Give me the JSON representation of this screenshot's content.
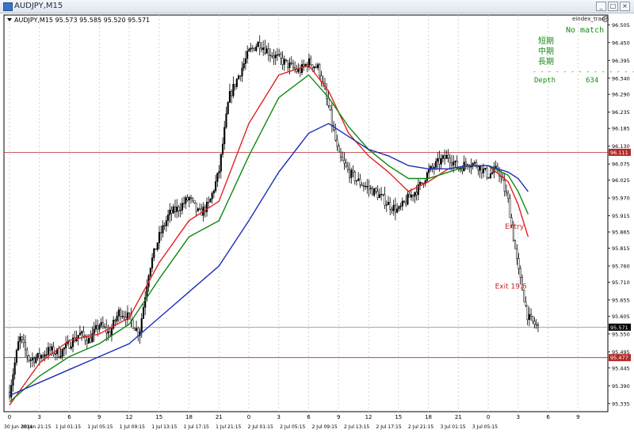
{
  "window": {
    "title": "AUDJPY,M15",
    "buttons": [
      "_",
      "□",
      "×"
    ]
  },
  "chart_info": "AUDJPY,M15  95.573 95.585 95.520 95.571",
  "indicator": {
    "name": "eindex_trade",
    "status": "No match",
    "labels": [
      "短期",
      "中期",
      "長期"
    ],
    "separator": "- - - - - - - - - - - - - -",
    "depth_label": "Depth",
    "depth_value": "634"
  },
  "chart_data": {
    "type": "candlestick",
    "symbol": "AUDJPY",
    "timeframe": "M15",
    "ohlc_header": {
      "open": 95.573,
      "high": 95.585,
      "low": 95.52,
      "close": 95.571
    },
    "ylim": [
      95.31,
      96.535
    ],
    "y_ticks": [
      96.505,
      96.45,
      96.395,
      96.34,
      96.29,
      96.235,
      96.185,
      96.13,
      96.075,
      96.025,
      95.97,
      95.915,
      95.865,
      95.815,
      95.76,
      95.71,
      95.655,
      95.605,
      95.55,
      95.495,
      95.445,
      95.39,
      95.335
    ],
    "x_ticks_top": [
      "0",
      "3",
      "6",
      "9",
      "12",
      "15",
      "18",
      "21",
      "0",
      "3",
      "6",
      "9",
      "12",
      "15",
      "18",
      "21",
      "0",
      "3",
      "6",
      "9"
    ],
    "x_ticks_bottom": [
      "30 Jun 2014",
      "30 Jun 21:15",
      "1 Jul 01:15",
      "1 Jul 05:15",
      "1 Jul 09:15",
      "1 Jul 13:15",
      "1 Jul 17:15",
      "1 Jul 21:15",
      "2 Jul 01:15",
      "2 Jul 05:15",
      "2 Jul 09:15",
      "2 Jul 13:15",
      "2 Jul 17:15",
      "2 Jul 21:15",
      "3 Jul 01:15",
      "3 Jul 05:15"
    ],
    "x_tick_label_positions": [
      0,
      3,
      6,
      9,
      12,
      15,
      18,
      21,
      24,
      27,
      30,
      33,
      36,
      39,
      42,
      45,
      48,
      51,
      54,
      57
    ],
    "price_anchors": [
      [
        0,
        95.37
      ],
      [
        1,
        95.54
      ],
      [
        2,
        95.47
      ],
      [
        3,
        95.48
      ],
      [
        4,
        95.5
      ],
      [
        5,
        95.49
      ],
      [
        6,
        95.52
      ],
      [
        7,
        95.55
      ],
      [
        8,
        95.53
      ],
      [
        9,
        95.58
      ],
      [
        10,
        95.55
      ],
      [
        11,
        95.62
      ],
      [
        12,
        95.6
      ],
      [
        13,
        95.55
      ],
      [
        14,
        95.75
      ],
      [
        15,
        95.85
      ],
      [
        16,
        95.92
      ],
      [
        17,
        95.94
      ],
      [
        18,
        95.97
      ],
      [
        19,
        95.92
      ],
      [
        20,
        95.95
      ],
      [
        21,
        96.05
      ],
      [
        22,
        96.28
      ],
      [
        23,
        96.35
      ],
      [
        24,
        96.42
      ],
      [
        25,
        96.45
      ],
      [
        26,
        96.42
      ],
      [
        27,
        96.4
      ],
      [
        28,
        96.38
      ],
      [
        29,
        96.36
      ],
      [
        30,
        96.39
      ],
      [
        31,
        96.37
      ],
      [
        32,
        96.25
      ],
      [
        33,
        96.1
      ],
      [
        34,
        96.05
      ],
      [
        35,
        96.02
      ],
      [
        36,
        96.0
      ],
      [
        37,
        95.98
      ],
      [
        38,
        95.95
      ],
      [
        39,
        95.93
      ],
      [
        40,
        95.97
      ],
      [
        41,
        96.0
      ],
      [
        42,
        96.05
      ],
      [
        43,
        96.08
      ],
      [
        44,
        96.1
      ],
      [
        45,
        96.06
      ],
      [
        46,
        96.08
      ],
      [
        47,
        96.07
      ],
      [
        48,
        96.04
      ],
      [
        49,
        96.06
      ],
      [
        50,
        95.96
      ],
      [
        51,
        95.75
      ],
      [
        52,
        95.6
      ],
      [
        53,
        95.57
      ]
    ],
    "moving_averages": [
      {
        "color": "#e52020",
        "points": [
          [
            0,
            95.33
          ],
          [
            3,
            95.46
          ],
          [
            6,
            95.53
          ],
          [
            9,
            95.55
          ],
          [
            12,
            95.6
          ],
          [
            15,
            95.77
          ],
          [
            18,
            95.9
          ],
          [
            21,
            95.96
          ],
          [
            24,
            96.2
          ],
          [
            27,
            96.35
          ],
          [
            30,
            96.38
          ],
          [
            32,
            96.3
          ],
          [
            34,
            96.17
          ],
          [
            36,
            96.1
          ],
          [
            38,
            96.05
          ],
          [
            40,
            95.99
          ],
          [
            42,
            96.02
          ],
          [
            44,
            96.06
          ],
          [
            46,
            96.07
          ],
          [
            48,
            96.07
          ],
          [
            50,
            96.02
          ],
          [
            51,
            95.95
          ],
          [
            52,
            95.85
          ]
        ]
      },
      {
        "color": "#108810",
        "points": [
          [
            0,
            95.34
          ],
          [
            3,
            95.42
          ],
          [
            6,
            95.48
          ],
          [
            9,
            95.52
          ],
          [
            12,
            95.58
          ],
          [
            15,
            95.72
          ],
          [
            18,
            95.85
          ],
          [
            21,
            95.9
          ],
          [
            24,
            96.1
          ],
          [
            27,
            96.28
          ],
          [
            30,
            96.35
          ],
          [
            32,
            96.28
          ],
          [
            34,
            96.19
          ],
          [
            36,
            96.12
          ],
          [
            38,
            96.07
          ],
          [
            40,
            96.03
          ],
          [
            42,
            96.03
          ],
          [
            44,
            96.05
          ],
          [
            46,
            96.07
          ],
          [
            48,
            96.07
          ],
          [
            50,
            96.04
          ],
          [
            51,
            95.99
          ],
          [
            52,
            95.92
          ]
        ]
      },
      {
        "color": "#1a2fb4",
        "points": [
          [
            0,
            95.36
          ],
          [
            3,
            95.4
          ],
          [
            6,
            95.44
          ],
          [
            9,
            95.48
          ],
          [
            12,
            95.52
          ],
          [
            15,
            95.6
          ],
          [
            18,
            95.68
          ],
          [
            21,
            95.76
          ],
          [
            24,
            95.9
          ],
          [
            27,
            96.05
          ],
          [
            30,
            96.17
          ],
          [
            32,
            96.2
          ],
          [
            34,
            96.16
          ],
          [
            36,
            96.12
          ],
          [
            38,
            96.1
          ],
          [
            40,
            96.07
          ],
          [
            42,
            96.06
          ],
          [
            44,
            96.06
          ],
          [
            46,
            96.07
          ],
          [
            48,
            96.07
          ],
          [
            50,
            96.05
          ],
          [
            51,
            96.03
          ],
          [
            52,
            95.99
          ]
        ]
      }
    ],
    "horizontal_lines": [
      {
        "price": 96.111,
        "label": "96.111",
        "color": "#b42828"
      },
      {
        "price": 95.571,
        "label": "95.571",
        "color": "#888888"
      },
      {
        "price": 95.477,
        "label": "95.477",
        "color": "#b42828"
      }
    ],
    "annotations": [
      {
        "text": "Entry",
        "x_index": 50,
        "price": 95.875,
        "color": "#c81e1e"
      },
      {
        "text": "Exit 19.6",
        "x_index": 49,
        "price": 95.69,
        "color": "#c81e1e"
      }
    ]
  }
}
